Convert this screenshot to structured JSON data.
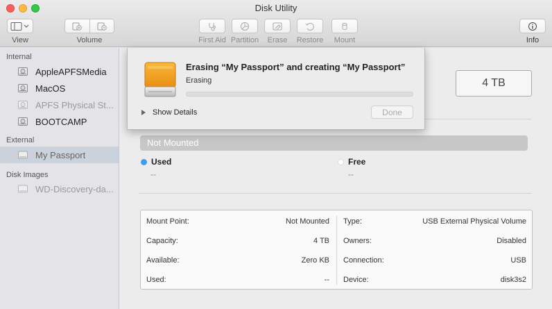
{
  "window": {
    "title": "Disk Utility"
  },
  "toolbar": {
    "view_label": "View",
    "volume_label": "Volume",
    "first_aid_label": "First Aid",
    "partition_label": "Partition",
    "erase_label": "Erase",
    "restore_label": "Restore",
    "mount_label": "Mount",
    "info_label": "Info"
  },
  "sidebar": {
    "sections": [
      {
        "title": "Internal"
      },
      {
        "title": "External"
      },
      {
        "title": "Disk Images"
      }
    ],
    "items": [
      {
        "label": "AppleAPFSMedia"
      },
      {
        "label": "MacOS"
      },
      {
        "label": "APFS Physical St..."
      },
      {
        "label": "BOOTCAMP"
      },
      {
        "label": "My Passport"
      },
      {
        "label": "WD-Discovery-da..."
      }
    ]
  },
  "main": {
    "capacity_box": "4 TB",
    "bar_label": "Not Mounted",
    "used": {
      "label": "Used",
      "value": "--",
      "color": "#3a9ff0"
    },
    "free": {
      "label": "Free",
      "value": "--",
      "color": "#ffffff"
    },
    "info": {
      "left": [
        {
          "key": "Mount Point:",
          "value": "Not Mounted"
        },
        {
          "key": "Capacity:",
          "value": "4 TB"
        },
        {
          "key": "Available:",
          "value": "Zero KB"
        },
        {
          "key": "Used:",
          "value": "--"
        }
      ],
      "right": [
        {
          "key": "Type:",
          "value": "USB External Physical Volume"
        },
        {
          "key": "Owners:",
          "value": "Disabled"
        },
        {
          "key": "Connection:",
          "value": "USB"
        },
        {
          "key": "Device:",
          "value": "disk3s2"
        }
      ]
    }
  },
  "sheet": {
    "title": "Erasing “My Passport” and creating “My Passport”",
    "status": "Erasing",
    "progress": 0,
    "show_details": "Show Details",
    "done_label": "Done"
  }
}
